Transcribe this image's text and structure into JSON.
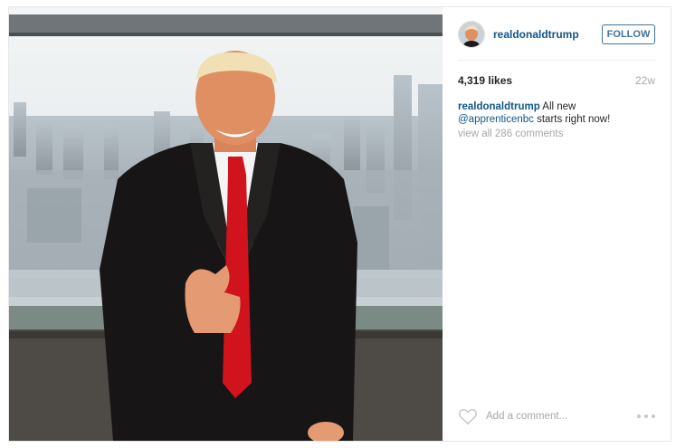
{
  "post": {
    "username": "realdonaldtrump",
    "follow_label": "FOLLOW",
    "likes": "4,319 likes",
    "age": "22w",
    "caption": {
      "user": "realdonaldtrump",
      "text_before_mention": " All new ",
      "mention": "@apprenticenbc",
      "text_after_mention": " starts right now!"
    },
    "view_all_comments": "view all 286 comments",
    "comment_placeholder": "Add a comment...",
    "icons": {
      "like": "heart-icon",
      "more": "more-options-icon",
      "avatar": "profile-avatar"
    }
  },
  "colors": {
    "link": "#125688",
    "follow": "#3f729b",
    "muted": "#a5a7aa",
    "tie": "#d0131d"
  }
}
